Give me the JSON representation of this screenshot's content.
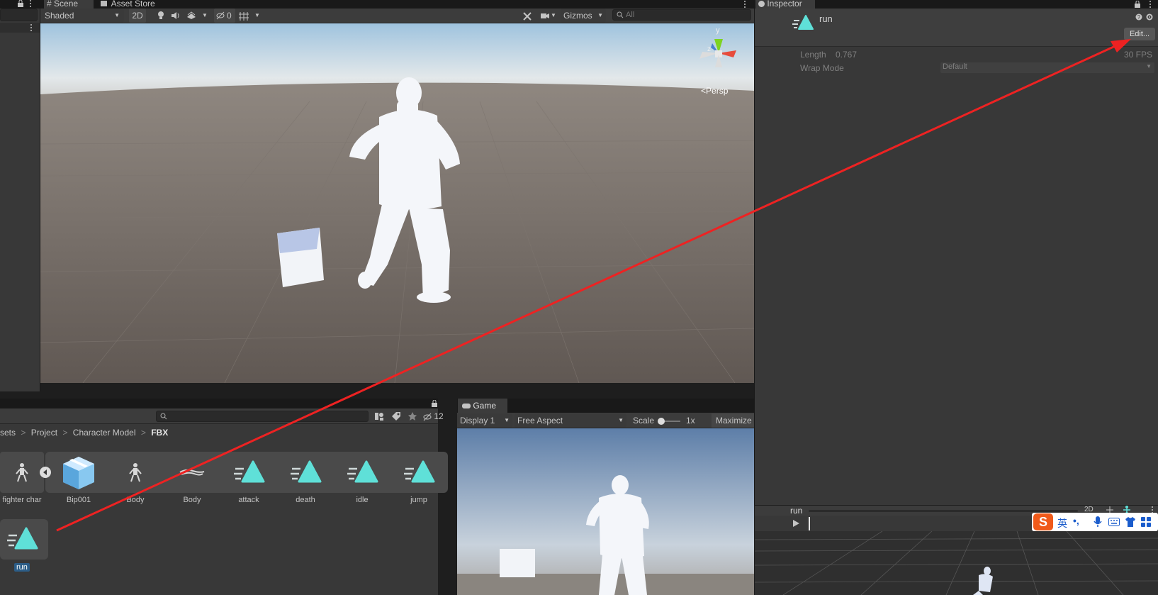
{
  "tabs": {
    "scene": "Scene",
    "asset_store": "Asset Store",
    "inspector": "Inspector",
    "game": "Game"
  },
  "scene_toolbar": {
    "shading_mode": "Shaded",
    "mode_2d": "2D",
    "hidden_count": "0",
    "gizmos": "Gizmos",
    "search_placeholder": "All"
  },
  "scene_view": {
    "persp_label": "Persp",
    "gizmo_y": "y",
    "gizmo_z": "z"
  },
  "inspector": {
    "asset_name": "run",
    "edit_button": "Edit...",
    "length_label": "Length",
    "length_value": "0.767",
    "fps_value": "30 FPS",
    "wrap_mode_label": "Wrap Mode",
    "wrap_mode_value": "Default"
  },
  "preview": {
    "clip_name": "run",
    "mode_2d": "2D"
  },
  "project": {
    "hidden_count": "12",
    "breadcrumb": [
      "sets",
      "Project",
      "Character Model",
      "FBX"
    ],
    "items": [
      {
        "label": "fighter char",
        "icon": "humanoid-model-icon"
      },
      {
        "label": "Bip001",
        "icon": "prefab-cube-icon"
      },
      {
        "label": "Body",
        "icon": "humanoid-model-icon"
      },
      {
        "label": "Body",
        "icon": "mesh-icon"
      },
      {
        "label": "attack",
        "icon": "animation-clip-icon"
      },
      {
        "label": "death",
        "icon": "animation-clip-icon"
      },
      {
        "label": "idle",
        "icon": "animation-clip-icon"
      },
      {
        "label": "jump",
        "icon": "animation-clip-icon"
      }
    ],
    "selected_item": {
      "label": "run",
      "icon": "animation-clip-icon"
    }
  },
  "game_toolbar": {
    "display": "Display 1",
    "aspect": "Free Aspect",
    "scale_label": "Scale",
    "scale_value": "1x",
    "maximize": "Maximize On Play"
  },
  "ime_bar": {
    "lang": "英",
    "punct": "•,"
  },
  "colors": {
    "annotation_arrow": "#ee2222",
    "clip_icon": "#5fe0d8",
    "selection": "#2c5d87"
  }
}
